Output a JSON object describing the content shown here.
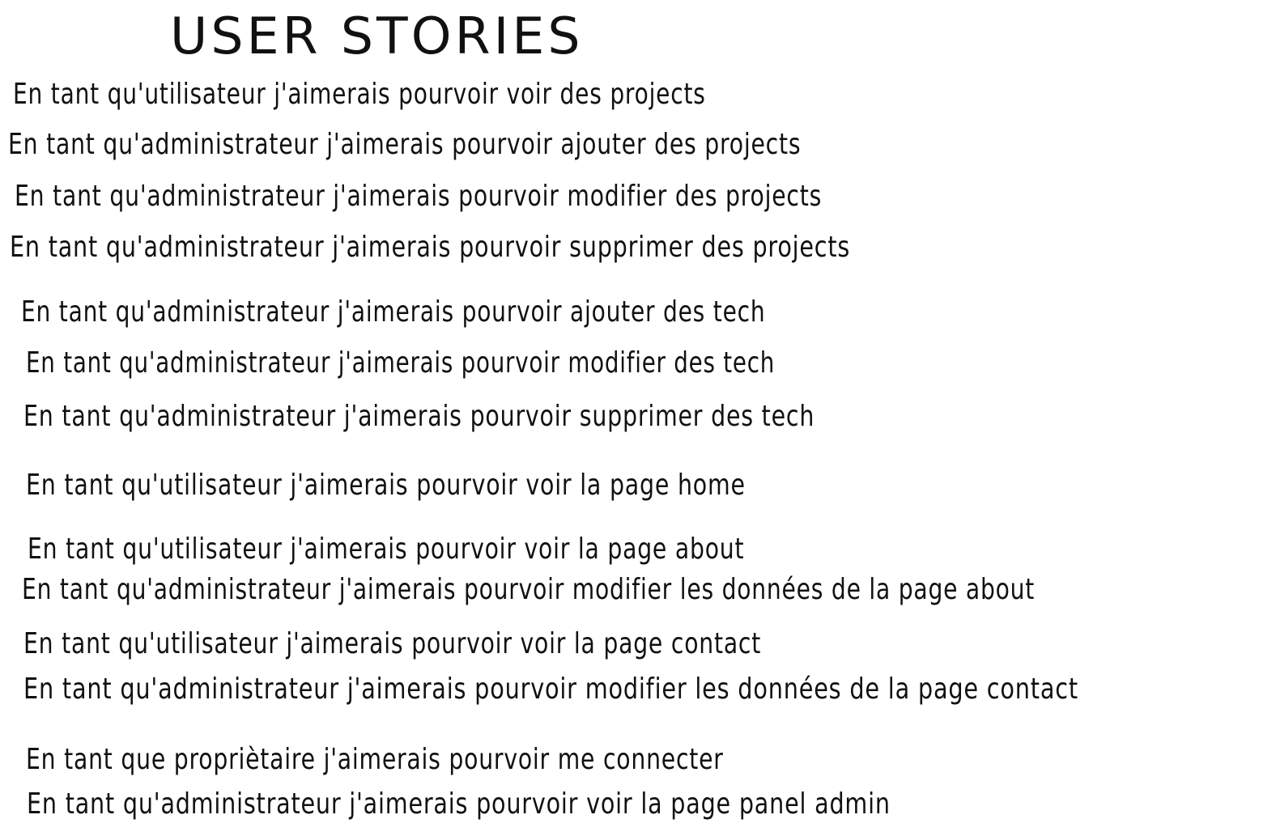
{
  "title": "USER STORIES",
  "stories": [
    "En tant qu'utilisateur j'aimerais pourvoir voir des projects",
    "En tant qu'administrateur j'aimerais pourvoir ajouter des projects",
    "En tant qu'administrateur j'aimerais pourvoir modifier des projects",
    "En tant qu'administrateur j'aimerais pourvoir supprimer des projects",
    "En tant qu'administrateur j'aimerais pourvoir ajouter des tech",
    "En tant qu'administrateur j'aimerais pourvoir modifier des tech",
    "En tant qu'administrateur j'aimerais pourvoir supprimer des tech",
    "En tant qu'utilisateur j'aimerais pourvoir voir la page home",
    "En tant qu'utilisateur j'aimerais pourvoir voir la page about",
    "En tant qu'administrateur j'aimerais pourvoir modifier les données de la page about",
    "En tant qu'utilisateur j'aimerais pourvoir voir la page contact",
    "En tant qu'administrateur j'aimerais pourvoir modifier les données de la page contact",
    "En tant que propriètaire j'aimerais pourvoir me connecter",
    "En tant qu'administrateur j'aimerais pourvoir voir la page panel admin"
  ]
}
